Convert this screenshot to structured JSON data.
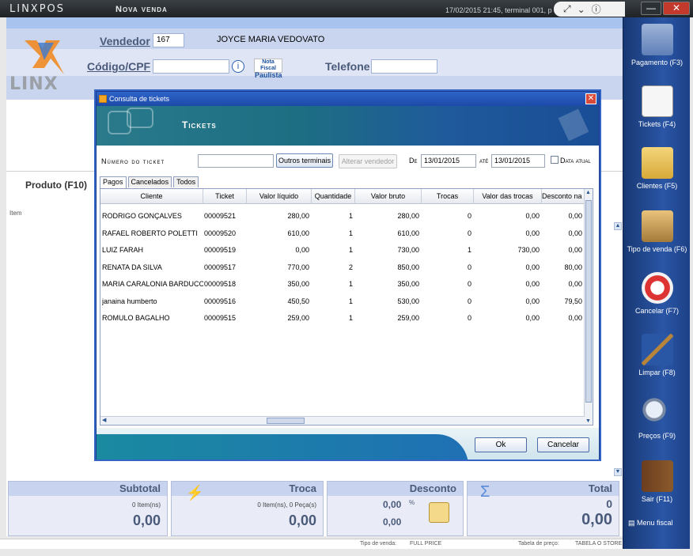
{
  "window": {
    "brand": "LINXPOS",
    "screen_title": "Nova venda",
    "status": "17/02/2015 21:45, terminal 001, p",
    "tool_icons": [
      "expand-icon",
      "chevron-down-icon",
      "info-icon"
    ],
    "controls": {
      "minimize": "—",
      "close": "✕"
    }
  },
  "header": {
    "logo_text": "LINX",
    "vendedor_label": "Vendedor",
    "vendedor_code": "167",
    "vendedor_name": "JOYCE MARIA VEDOVATO",
    "codigo_cpf_label": "Código/CPF",
    "codigo_cpf_value": "",
    "nota_fiscal_badge_line1": "Nota Fiscal",
    "nota_fiscal_badge_line2": "Paulista",
    "telefone_label": "Telefone",
    "telefone_value": ""
  },
  "product": {
    "label": "Produto (F10)",
    "item_label": "Item"
  },
  "totals": {
    "subtotal": {
      "label": "Subtotal",
      "items": "0 Item(ns)",
      "value": "0,00"
    },
    "troca": {
      "label": "Troca",
      "items": "0 Item(ns), 0 Peça(s)",
      "value": "0,00"
    },
    "desconto": {
      "label": "Desconto",
      "percent": "0,00",
      "percent_symbol": "%",
      "value": "0,00"
    },
    "total": {
      "label": "Total",
      "count": "0",
      "value": "0,00"
    }
  },
  "statusbar": {
    "tipo_venda_label": "Tipo de venda:",
    "tipo_venda_value": "FULL PRICE",
    "tabela_label": "Tabela de preço:",
    "tabela_value": "TABELA O STORE"
  },
  "sidebar": {
    "buttons": [
      {
        "label": "Pagamento (F3)",
        "icon": "payment-icon"
      },
      {
        "label": "Tickets (F4)",
        "icon": "tickets-icon"
      },
      {
        "label": "Clientes (F5)",
        "icon": "clients-icon"
      },
      {
        "label": "Tipo de venda (F6)",
        "icon": "sale-type-icon"
      },
      {
        "label": "Cancelar (F7)",
        "icon": "cancel-icon"
      },
      {
        "label": "Limpar (F8)",
        "icon": "broom-icon"
      },
      {
        "label": "Preços (F9)",
        "icon": "magnifier-icon"
      },
      {
        "label": "Sair (F11)",
        "icon": "exit-door-icon"
      }
    ],
    "menu_fiscal": "Menu fiscal"
  },
  "dialog": {
    "title": "Consulta de tickets",
    "banner_title": "Tickets",
    "numero_label": "Número do ticket",
    "numero_value": "",
    "outros_terminais": "Outros terminais",
    "alterar_vendedor": "Alterar vendedor",
    "de_label": "De",
    "de_value": "13/01/2015",
    "ate_label": "até",
    "ate_value": "13/01/2015",
    "data_atual_label": "Data atual",
    "tabs": [
      "Pagos",
      "Cancelados",
      "Todos"
    ],
    "columns": [
      "Cliente",
      "Ticket",
      "Valor líquido",
      "Quantidade",
      "Valor bruto",
      "Trocas",
      "Valor das trocas",
      "Desconto na v"
    ],
    "rows": [
      [
        "RODRIGO GONÇALVES",
        "00009521",
        "280,00",
        "1",
        "280,00",
        "0",
        "0,00",
        "0,00"
      ],
      [
        "RAFAEL ROBERTO POLETTI",
        "00009520",
        "610,00",
        "1",
        "610,00",
        "0",
        "0,00",
        "0,00"
      ],
      [
        "LUIZ FARAH",
        "00009519",
        "0,00",
        "1",
        "730,00",
        "1",
        "730,00",
        "0,00"
      ],
      [
        "RENATA DA SILVA",
        "00009517",
        "770,00",
        "2",
        "850,00",
        "0",
        "0,00",
        "80,00"
      ],
      [
        "MARIA CARALONIA BARDUCO KO",
        "00009518",
        "350,00",
        "1",
        "350,00",
        "0",
        "0,00",
        "0,00"
      ],
      [
        "janaina humberto",
        "00009516",
        "450,50",
        "1",
        "530,00",
        "0",
        "0,00",
        "79,50"
      ],
      [
        "ROMULO BAGALHO",
        "00009515",
        "259,00",
        "1",
        "259,00",
        "0",
        "0,00",
        "0,00"
      ]
    ],
    "ok_label": "Ok",
    "cancelar_label": "Cancelar"
  }
}
